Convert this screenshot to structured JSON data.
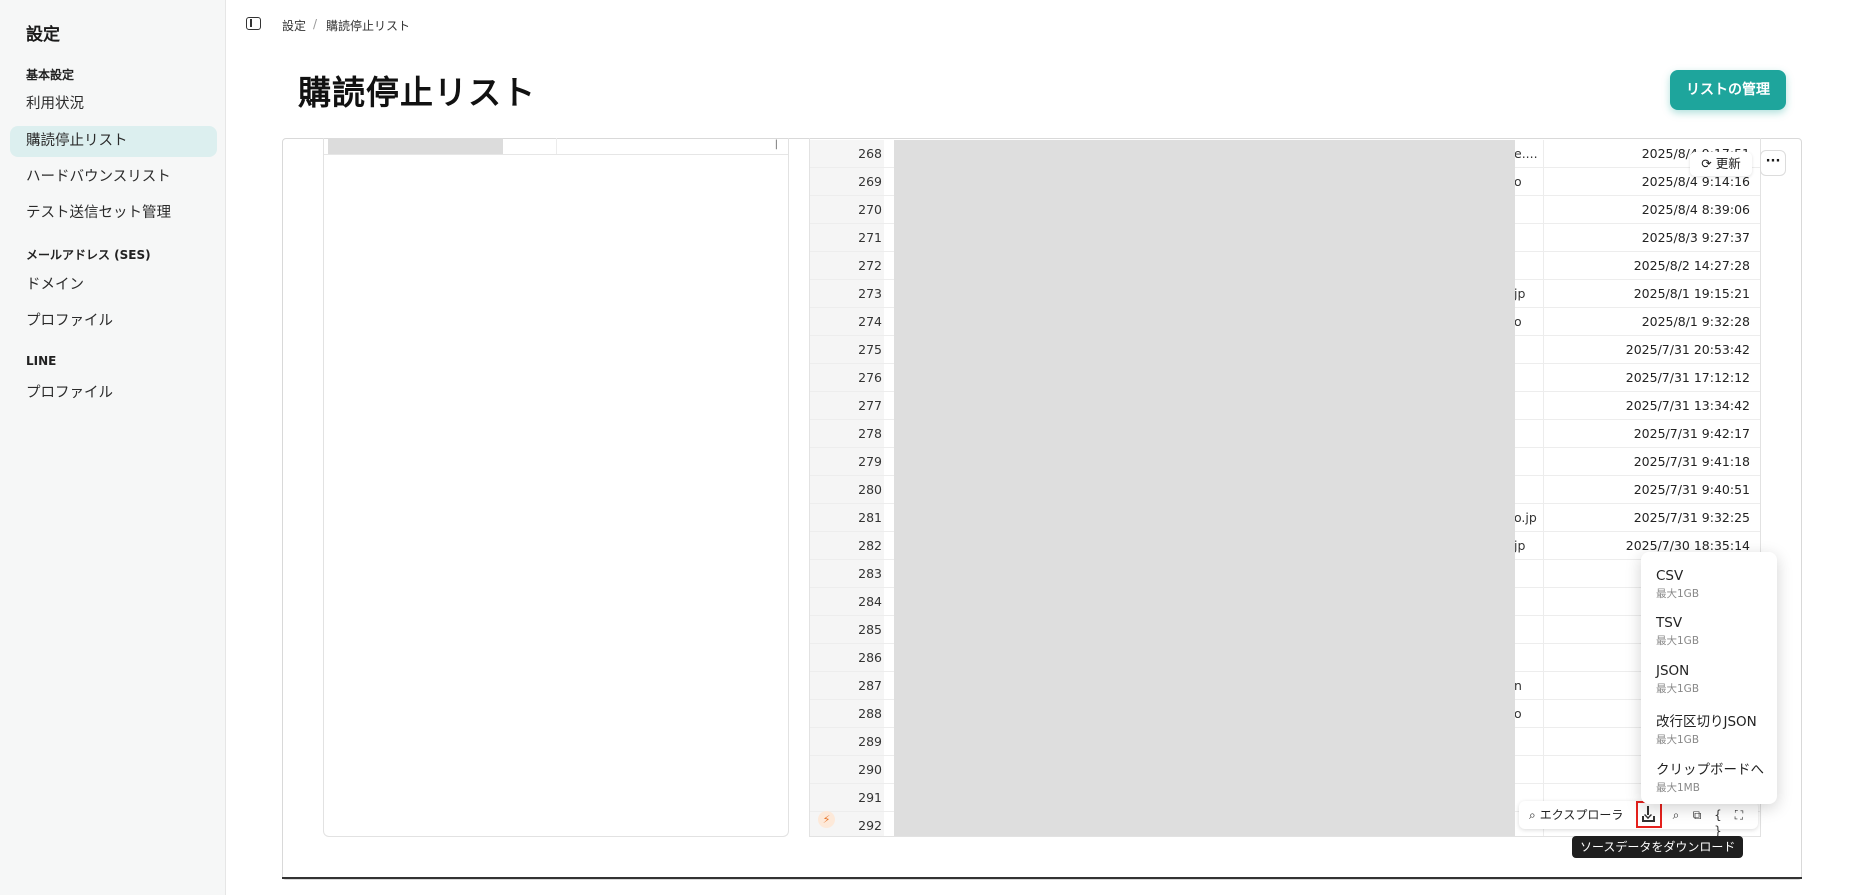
{
  "sidebar": {
    "title": "設定",
    "sections": [
      {
        "heading": "基本設定",
        "items": [
          {
            "label": "利用状況",
            "active": false
          },
          {
            "label": "購読停止リスト",
            "active": true
          },
          {
            "label": "ハードバウンスリスト",
            "active": false
          },
          {
            "label": "テスト送信セット管理",
            "active": false
          }
        ]
      },
      {
        "heading": "メールアドレス (SES)",
        "items": [
          {
            "label": "ドメイン",
            "active": false
          },
          {
            "label": "プロファイル",
            "active": false
          }
        ]
      },
      {
        "heading": "LINE",
        "items": [
          {
            "label": "プロファイル",
            "active": false
          }
        ]
      }
    ]
  },
  "breadcrumb": [
    "設定",
    "購読停止リスト"
  ],
  "breadcrumb_sep": "/",
  "page": {
    "title": "購読停止リスト",
    "manage_button": "リストの管理"
  },
  "left_panel": {
    "header_mark": "|"
  },
  "table": {
    "refresh_label": "更新",
    "more_label": "···",
    "rows": [
      {
        "num": "268",
        "frag": "e....",
        "date": "2025/8/4 9:17:51"
      },
      {
        "num": "269",
        "frag": "o",
        "date": "2025/8/4 9:14:16"
      },
      {
        "num": "270",
        "frag": "",
        "date": "2025/8/4 8:39:06"
      },
      {
        "num": "271",
        "frag": "",
        "date": "2025/8/3 9:27:37"
      },
      {
        "num": "272",
        "frag": "",
        "date": "2025/8/2 14:27:28"
      },
      {
        "num": "273",
        "frag": "jp",
        "date": "2025/8/1 19:15:21"
      },
      {
        "num": "274",
        "frag": "o",
        "date": "2025/8/1 9:32:28"
      },
      {
        "num": "275",
        "frag": "",
        "date": "2025/7/31 20:53:42"
      },
      {
        "num": "276",
        "frag": "",
        "date": "2025/7/31 17:12:12"
      },
      {
        "num": "277",
        "frag": "",
        "date": "2025/7/31 13:34:42"
      },
      {
        "num": "278",
        "frag": "",
        "date": "2025/7/31 9:42:17"
      },
      {
        "num": "279",
        "frag": "",
        "date": "2025/7/31 9:41:18"
      },
      {
        "num": "280",
        "frag": "",
        "date": "2025/7/31 9:40:51"
      },
      {
        "num": "281",
        "frag": "o.jp",
        "date": "2025/7/31 9:32:25"
      },
      {
        "num": "282",
        "frag": "jp",
        "date": "2025/7/30 18:35:14"
      },
      {
        "num": "283",
        "frag": "",
        "date": "2"
      },
      {
        "num": "284",
        "frag": "",
        "date": ""
      },
      {
        "num": "285",
        "frag": "",
        "date": ""
      },
      {
        "num": "286",
        "frag": "",
        "date": ""
      },
      {
        "num": "287",
        "frag": "n",
        "date": "2"
      },
      {
        "num": "288",
        "frag": "o",
        "date": ""
      },
      {
        "num": "289",
        "frag": "",
        "date": "2"
      },
      {
        "num": "290",
        "frag": "",
        "date": "2"
      },
      {
        "num": "291",
        "frag": "",
        "date": ""
      },
      {
        "num": "292",
        "frag": "",
        "date": ""
      }
    ]
  },
  "toolbar": {
    "explorer_label": "エクスプローラ",
    "download_tooltip": "ソースデータをダウンロード"
  },
  "download_menu": [
    {
      "label": "CSV",
      "sub": "最大1GB"
    },
    {
      "label": "TSV",
      "sub": "最大1GB"
    },
    {
      "label": "JSON",
      "sub": "最大1GB"
    },
    {
      "label": "改行区切りJSON",
      "sub": "最大1GB"
    },
    {
      "label": "クリップボードへ",
      "sub": "最大1MB"
    }
  ],
  "colors": {
    "accent": "#1ea59c",
    "active_bg": "#dcefef",
    "highlight": "#e5211d"
  }
}
